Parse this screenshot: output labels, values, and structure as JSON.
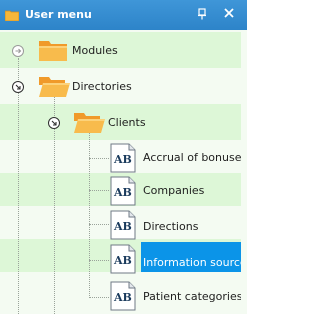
{
  "window": {
    "title": "User menu"
  },
  "titlebar": {
    "buttons": [
      "pin-icon",
      "close-icon"
    ]
  },
  "tree": {
    "modules": {
      "label": "Modules",
      "expander": "expand-arrow-icon",
      "icon": "folder-icon"
    },
    "directories": {
      "label": "Directories",
      "expander": "collapse-arrow-icon",
      "icon": "folder-open-icon"
    },
    "clients": {
      "label": "Clients",
      "expander": "collapse-arrow-icon",
      "icon": "folder-open-icon"
    },
    "items": [
      {
        "label": "Accrual of bonuses",
        "icon": "ab-document-icon"
      },
      {
        "label": "Companies",
        "icon": "ab-document-icon"
      },
      {
        "label": "Directions",
        "icon": "ab-document-icon"
      },
      {
        "label": "Information sources",
        "icon": "ab-document-icon",
        "selected": true
      },
      {
        "label": "Patient categories",
        "icon": "ab-document-icon"
      }
    ],
    "doc_icon_text": "AB"
  },
  "colors": {
    "titlebar": "#3f96d8",
    "selection": "#0b94e8",
    "row_alt": "#ddf7d7",
    "row_plain": "#f4fbf2"
  }
}
